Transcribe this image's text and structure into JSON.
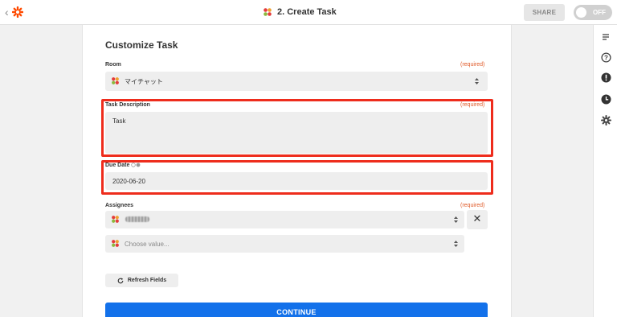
{
  "header": {
    "back_glyph": "‹",
    "step_title": "2. Create Task",
    "share_label": "SHARE",
    "toggle_label": "OFF"
  },
  "form": {
    "title": "Customize Task",
    "room": {
      "label": "Room",
      "required": "(required)",
      "value": "マイチャット"
    },
    "task_description": {
      "label": "Task Description",
      "required": "(required)",
      "value": "Task"
    },
    "due_date": {
      "label": "Due Date",
      "value": "2020-06-20"
    },
    "assignees": {
      "label": "Assignees",
      "required": "(required)",
      "placeholder": "Choose value...",
      "clear_glyph": "✕"
    },
    "refresh_label": "Refresh Fields",
    "continue_label": "CONTINUE"
  },
  "colors": {
    "brand_orange": "#ff4a00",
    "highlight_red": "#ee2c1c",
    "required_orange": "#e05a28",
    "primary_blue": "#1371ea"
  },
  "icons": {
    "logo": "zapier-asterisk-icon",
    "app": "chatwork-app-icon",
    "rail": [
      "details-icon",
      "help-icon",
      "alert-icon",
      "history-icon",
      "settings-icon"
    ]
  }
}
